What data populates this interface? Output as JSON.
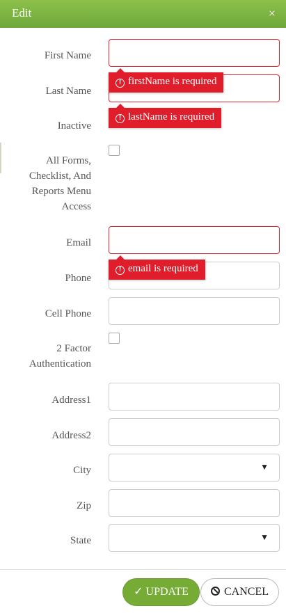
{
  "dialog": {
    "title": "Edit",
    "close_glyph": "×"
  },
  "fields": {
    "first_name": {
      "label": "First Name",
      "value": "",
      "error": "firstName is required"
    },
    "last_name": {
      "label": "Last Name",
      "value": "",
      "error": "lastName is required"
    },
    "inactive": {
      "label": "Inactive"
    },
    "all_forms": {
      "label_lines": [
        "All Forms,",
        "Checklist, And",
        "Reports Menu",
        "Access"
      ],
      "checked": false
    },
    "email": {
      "label": "Email",
      "value": "",
      "error": "email is required"
    },
    "phone": {
      "label": "Phone",
      "value": ""
    },
    "cell_phone": {
      "label": "Cell Phone",
      "value": ""
    },
    "two_factor": {
      "label_lines": [
        "2 Factor",
        "Authentication"
      ],
      "checked": false
    },
    "address1": {
      "label": "Address1",
      "value": ""
    },
    "address2": {
      "label": "Address2",
      "value": ""
    },
    "city": {
      "label": "City",
      "value": ""
    },
    "zip": {
      "label": "Zip",
      "value": ""
    },
    "state": {
      "label": "State",
      "value": ""
    }
  },
  "error_icon": "!",
  "buttons": {
    "update": "UPDATE",
    "cancel": "CANCEL"
  },
  "colors": {
    "header_green": "#6ea83a",
    "error_red": "#e01e2b",
    "update_green": "#76ab36"
  }
}
